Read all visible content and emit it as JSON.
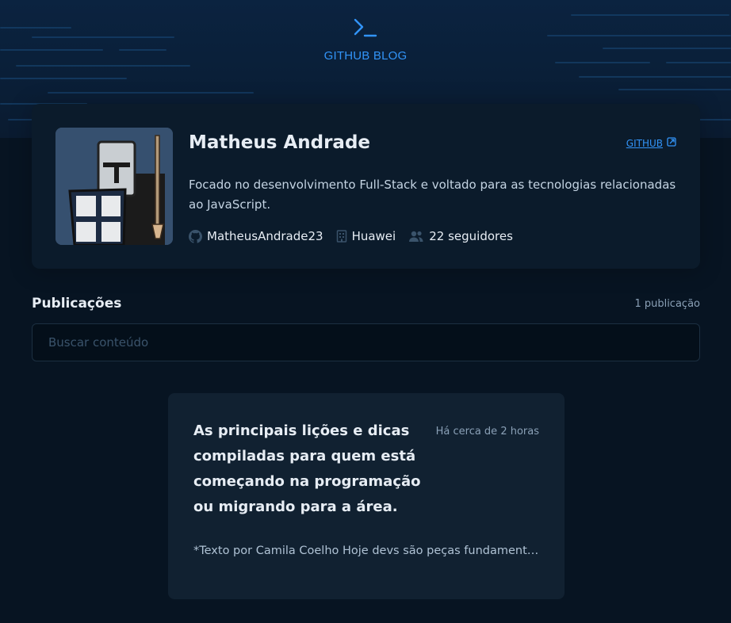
{
  "brand": {
    "name": "GITHUB BLOG",
    "icon": "terminal-icon",
    "accent": "#3294f8"
  },
  "profile": {
    "name": "Matheus Andrade",
    "github_label": "GITHUB",
    "bio": "Focado no desenvolvimento Full-Stack e voltado para as tecnologias relacionadas ao JavaScript.",
    "username": "MatheusAndrade23",
    "company": "Huawei",
    "followers": "22 seguidores",
    "avatar_icon": "knight-avatar"
  },
  "publications": {
    "title": "Publicações",
    "count": "1 publicação",
    "search_placeholder": "Buscar conteúdo"
  },
  "posts": [
    {
      "title": "As principais lições e dicas compiladas para quem está começando na programação ou migrando para a área.",
      "time": "Há cerca de 2 horas",
      "excerpt": "*Texto por Camila Coelho Hoje devs são peças fundamenta..."
    }
  ]
}
